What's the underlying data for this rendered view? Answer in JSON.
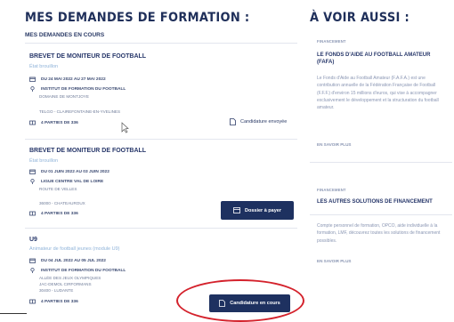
{
  "left": {
    "title": "MES DEMANDES DE FORMATION :",
    "subtitle": "MES DEMANDES EN COURS",
    "cards": [
      {
        "title": "BREVET DE MONITEUR DE FOOTBALL",
        "subtitle": "État brouillon",
        "date": "DU 24 MAI 2022 AU 27 MAI 2022",
        "org": "INSTITUT DE FORMATION DU FOOTBALL",
        "org_detail": "DOMAINE DE MONTJOYE",
        "location": "TELGO - CLAIREFONTAINE-EN-YVELINES",
        "places": "4 PARTIES DE 336",
        "action": "Candidature envoyée"
      },
      {
        "title": "BREVET DE MONITEUR DE FOOTBALL",
        "subtitle": "État brouillon",
        "date": "DU 01 JUIN 2022 AU 03 JUIN 2022",
        "org": "LIGUE CENTRE VAL DE LOIRE",
        "org_detail": "ROUTE DE VELLES",
        "location": "36000 - CHATEAUROUX",
        "places": "4 PARTIES DE 336",
        "action": "Dossier à payer"
      },
      {
        "title": "U9",
        "subtitle": "Animateur de football jeunes (module U9)",
        "date": "DU 04 JUL 2022 AU 05 JUL 2022",
        "org": "INSTITUT DE FORMATION DU FOOTBALL",
        "org_detail": "ALLÉE DES JEUX OLYMPIQUES",
        "org_detail2": "JAC-DEMOL CIRFORMANS",
        "location": "30400 - LUDANTE",
        "places": "4 PARTIES DE 336",
        "action": "Candidature en cours"
      }
    ]
  },
  "right": {
    "title": "À VOIR AUSSI :",
    "items": [
      {
        "tag": "FINANCEMENT",
        "title": "LE FONDS D'AIDE AU FOOTBALL AMATEUR (FAFA)",
        "text": "Le Fonds d'Aide au Football Amateur (F.A.F.A.) est une contribution annuelle de la Fédération Française de Football (F.F.F.) d'environ 15 millions d'euros, qui vise à accompagner exclusivement le développement et la structuration du football amateur.",
        "link": "EN SAVOIR PLUS"
      },
      {
        "tag": "FINANCEMENT",
        "title": "LES AUTRES SOLUTIONS DE FINANCEMENT",
        "text": "Compte personnel de formation, OPCO, aide individuelle à la formation, LMF, découvrez toutes les solutions de financement possibles.",
        "link": "EN SAVOIR PLUS"
      }
    ]
  },
  "colors": {
    "navy": "#1e3160",
    "accent_light": "#8fb3d9",
    "highlight": "#d4222c"
  }
}
